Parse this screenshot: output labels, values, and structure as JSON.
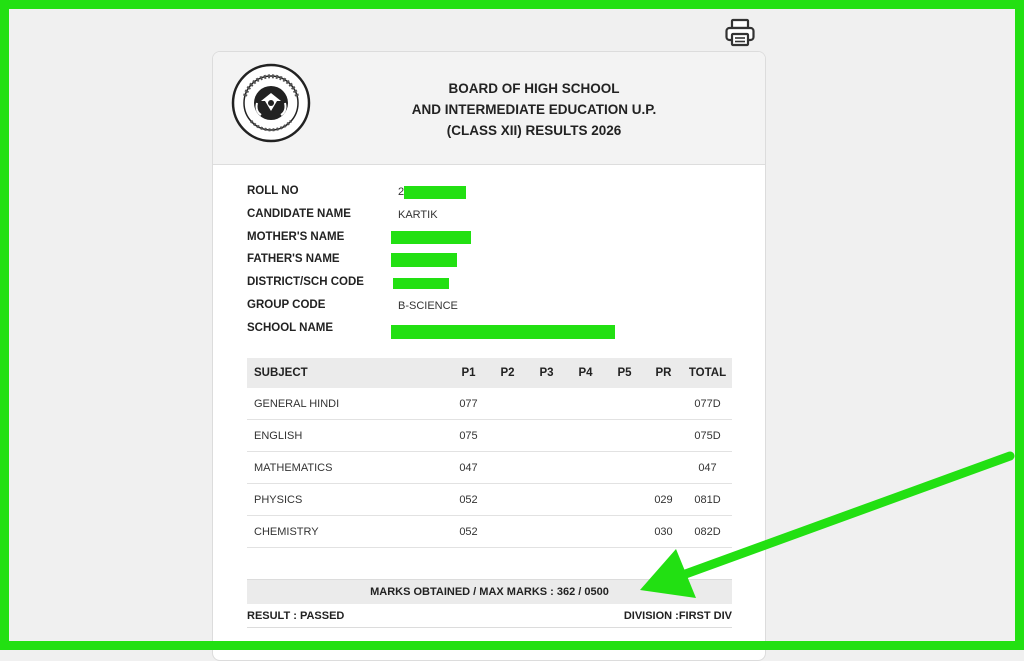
{
  "toolbar": {
    "print_icon": "printer-icon"
  },
  "header": {
    "logo_icon": "board-emblem-icon",
    "title_lines": [
      "BOARD OF HIGH SCHOOL",
      "AND INTERMEDIATE EDUCATION U.P.",
      "(CLASS XII) RESULTS 2026"
    ]
  },
  "student": {
    "roll_no_label": "ROLL NO",
    "roll_no_value": "2",
    "candidate_name_label": "CANDIDATE NAME",
    "candidate_name_value": "KARTIK",
    "mother_name_label": "MOTHER'S NAME",
    "father_name_label": "FATHER'S NAME",
    "district_label": "DISTRICT/SCH CODE",
    "group_code_label": "GROUP CODE",
    "group_code_value": "B-SCIENCE",
    "school_name_label": "SCHOOL NAME"
  },
  "marks": {
    "headers": [
      "SUBJECT",
      "P1",
      "P2",
      "P3",
      "P4",
      "P5",
      "PR",
      "TOTAL"
    ],
    "rows": [
      [
        "GENERAL HINDI",
        "077",
        "",
        "",
        "",
        "",
        "",
        "077D"
      ],
      [
        "ENGLISH",
        "075",
        "",
        "",
        "",
        "",
        "",
        "075D"
      ],
      [
        "MATHEMATICS",
        "047",
        "",
        "",
        "",
        "",
        "",
        "047"
      ],
      [
        "PHYSICS",
        "052",
        "",
        "",
        "",
        "",
        "029",
        "081D"
      ],
      [
        "CHEMISTRY",
        "052",
        "",
        "",
        "",
        "",
        "030",
        "082D"
      ]
    ]
  },
  "summary": {
    "marks_obtained": "MARKS OBTAINED / MAX MARKS : 362 / 0500",
    "result": "RESULT : PASSED",
    "division": "DIVISION :FIRST DIV"
  },
  "colors": {
    "highlight": "#22e012",
    "header_bg": "#f3f3f3",
    "table_head_bg": "#ebebeb"
  }
}
